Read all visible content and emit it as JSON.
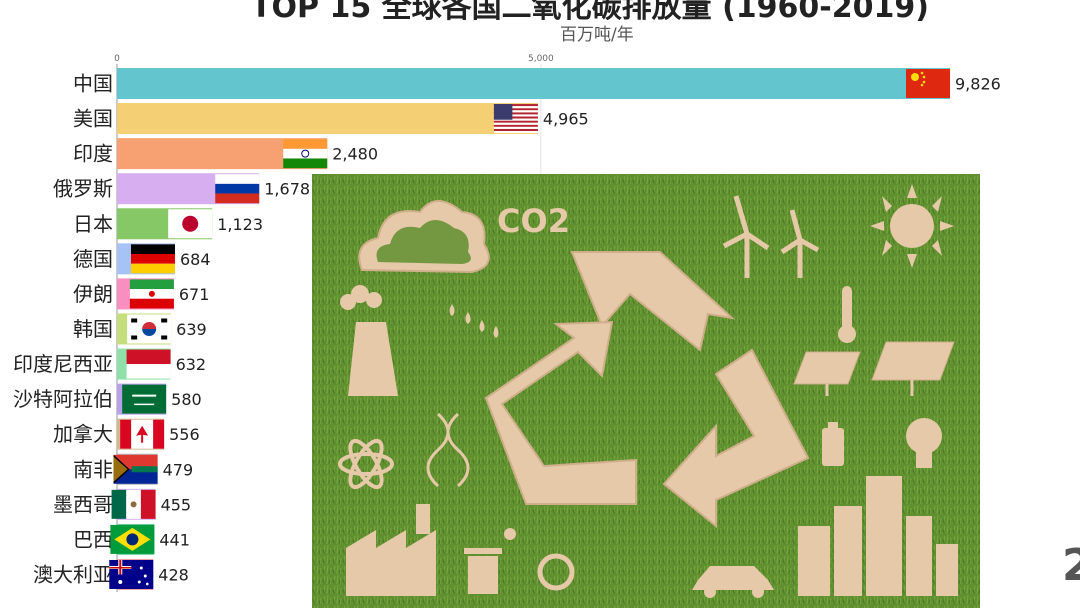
{
  "title": "TOP 15 全球各国二氧化碳排放量 (1960-2019)",
  "subtitle": "百万吨/年",
  "year_fragment": "2",
  "chart_data": {
    "type": "bar",
    "orientation": "horizontal",
    "title": "TOP 15 全球各国二氧化碳排放量 (1960-2019)",
    "subtitle": "百万吨/年",
    "xlim": [
      0,
      9826
    ],
    "ticks": [
      {
        "value": 0,
        "label": "0"
      },
      {
        "value": 5000,
        "label": "5,000"
      }
    ],
    "categories": [
      "中国",
      "美国",
      "印度",
      "俄罗斯",
      "日本",
      "德国",
      "伊朗",
      "韩国",
      "印度尼西亚",
      "沙特阿拉伯",
      "加拿大",
      "南非",
      "墨西哥",
      "巴西",
      "澳大利亚"
    ],
    "values": [
      9826,
      4965,
      2480,
      1678,
      1123,
      684,
      671,
      639,
      632,
      580,
      556,
      479,
      455,
      441,
      428
    ],
    "value_labels": [
      "9,826",
      "4,965",
      "2,480",
      "1,678",
      "1,123",
      "684",
      "671",
      "639",
      "632",
      "580",
      "556",
      "479",
      "455",
      "441",
      "428"
    ],
    "colors": [
      "#63c5ce",
      "#f5cf74",
      "#f7a071",
      "#d7aef0",
      "#86c865",
      "#a7c2f4",
      "#f98fbf",
      "#c4de7c",
      "#8ee0a8",
      "#b9a1ea",
      "#d4b88e",
      "#b7b7b7",
      "#d4b7f5",
      "#72d1ab",
      "#f4a4a4"
    ],
    "flags": [
      "china-flag",
      "usa-flag",
      "india-flag",
      "russia-flag",
      "japan-flag",
      "germany-flag",
      "iran-flag",
      "south-korea-flag",
      "indonesia-flag",
      "saudi-arabia-flag",
      "canada-flag",
      "south-africa-flag",
      "mexico-flag",
      "brazil-flag",
      "australia-flag"
    ],
    "grid": true
  },
  "overlay": {
    "icon_label": "CO2"
  },
  "colors": {
    "grass": "#5f8f2f",
    "cardboard": "#e6c9a8"
  }
}
